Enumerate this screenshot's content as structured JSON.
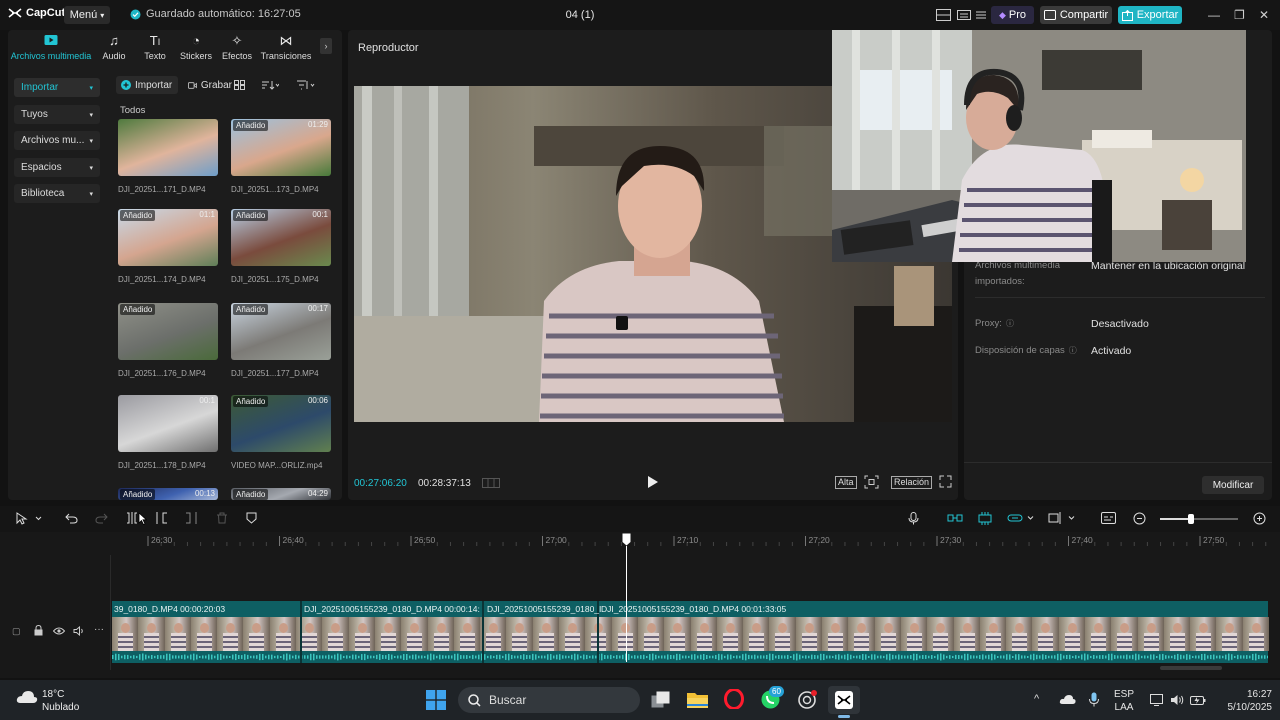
{
  "app": {
    "name": "CapCut",
    "menu_label": "Menú",
    "autosave": "Guardado automático: 16:27:05",
    "project_name": "04 (1)",
    "pro_label": "Pro",
    "share_label": "Compartir",
    "export_label": "Exportar",
    "accent": "#22c5d4"
  },
  "media_tabs": [
    {
      "label": "Archivos multimedia",
      "icon": "media-icon"
    },
    {
      "label": "Audio",
      "icon": "audio-icon"
    },
    {
      "label": "Texto",
      "icon": "text-icon"
    },
    {
      "label": "Stickers",
      "icon": "sticker-icon"
    },
    {
      "label": "Efectos",
      "icon": "effects-icon"
    },
    {
      "label": "Transiciones",
      "icon": "transitions-icon"
    }
  ],
  "sidebar": [
    {
      "label": "Importar"
    },
    {
      "label": "Tuyos"
    },
    {
      "label": "Archivos mu..."
    },
    {
      "label": "Espacios"
    },
    {
      "label": "Biblioteca"
    }
  ],
  "media_toolbar": {
    "import_label": "Importar",
    "record_label": "Grabar",
    "section_label": "Todos"
  },
  "media_items": [
    {
      "name": "DJI_20251...171_D.MP4",
      "badge": "",
      "duration": ""
    },
    {
      "name": "DJI_20251...173_D.MP4",
      "badge": "Añadido",
      "duration": "01:29"
    },
    {
      "name": "DJI_20251...174_D.MP4",
      "badge": "Añadido",
      "duration": "01:1"
    },
    {
      "name": "DJI_20251...175_D.MP4",
      "badge": "Añadido",
      "duration": "00:1"
    },
    {
      "name": "DJI_20251...176_D.MP4",
      "badge": "Añadido",
      "duration": ""
    },
    {
      "name": "DJI_20251...177_D.MP4",
      "badge": "Añadido",
      "duration": "00:17"
    },
    {
      "name": "DJI_20251...178_D.MP4",
      "badge": "",
      "duration": "00:1"
    },
    {
      "name": "VIDEO MAP...ORLIZ.mp4",
      "badge": "Añadido",
      "duration": "00:06"
    },
    {
      "name": "",
      "badge": "Añadido",
      "duration": "00:13"
    },
    {
      "name": "",
      "badge": "Añadido",
      "duration": "04:29"
    }
  ],
  "player": {
    "title": "Reproductor",
    "current_time": "00:27:06:20",
    "total_time": "00:28:37:13",
    "quality_label": "Alta",
    "ratio_label": "Relación"
  },
  "details": {
    "rows": [
      {
        "key": "Archivos multimedia importados:",
        "value": "Mantener en la ubicación original"
      },
      {
        "key": "Proxy:",
        "value": "Desactivado"
      },
      {
        "key": "Disposición de capas",
        "value": "Activado"
      }
    ],
    "modify_label": "Modificar"
  },
  "timeline": {
    "ruler_labels": [
      "26:30",
      "26:40",
      "26:50",
      "27:00",
      "27:10",
      "27:20",
      "27:30",
      "27:40",
      "27:50"
    ],
    "clips": [
      {
        "label": "39_0180_D.MP4   00:00:20:03"
      },
      {
        "label": "DJI_20251005155239_0180_D.MP4   00:00:14:"
      },
      {
        "label": "DJI_20251005155239_0180_I"
      },
      {
        "label": "DJI_20251005155239_0180_D.MP4   00:01:33:05"
      }
    ]
  },
  "taskbar": {
    "temperature": "18°C",
    "weather": "Nublado",
    "search_placeholder": "Buscar",
    "whatsapp_badge": "60",
    "lang": "ESP",
    "layout": "LAA",
    "time": "16:27",
    "date": "5/10/2025"
  }
}
